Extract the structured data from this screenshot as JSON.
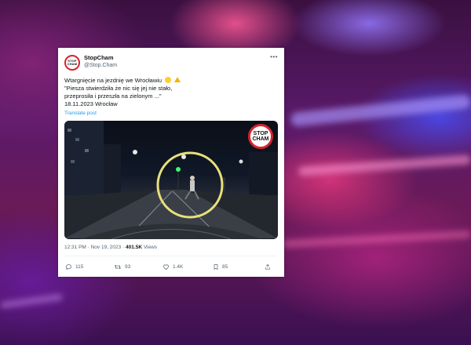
{
  "tweet": {
    "avatar_line1": "STOP",
    "avatar_line2": "CHAM",
    "display_name": "StopCham",
    "handle": "@Stop.Cham",
    "text_line1": "Wtargnięcie na jezdnię we Wrocławiu",
    "text_line2": "\"Piesza stwierdziła że nic się jej nie stało,",
    "text_line3": "przeprosiła i przeszła na zielonym ...\"",
    "text_line4": "18.11.2023 Wrocław",
    "translate": "Translate post",
    "media_logo_line1": "STOP",
    "media_logo_line2": "CHAM",
    "time": "12:31 PM · Nov 19, 2023 · ",
    "views_count": "401.5K",
    "views_label": " Views",
    "replies": "115",
    "retweets": "93",
    "likes": "1.4K",
    "bookmarks": "85"
  },
  "icons": [
    "more-icon",
    "scared-emoji-icon",
    "warning-emoji-icon",
    "reply-icon",
    "retweet-icon",
    "like-icon",
    "bookmark-icon",
    "share-icon"
  ],
  "colors": {
    "brand_red": "#d9242b",
    "link_blue": "#1d9bf0",
    "circle_yellow": "#e8e07a"
  }
}
